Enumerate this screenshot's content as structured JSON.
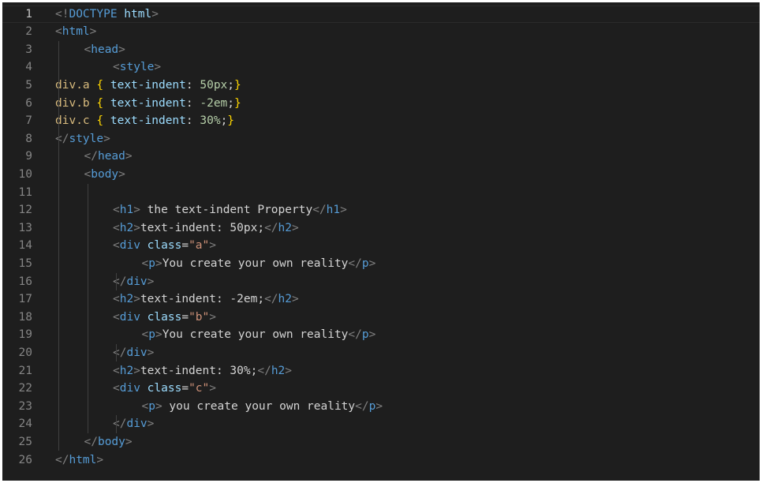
{
  "editor": {
    "current_line": 1,
    "lines": [
      {
        "n": "1",
        "indent": 0,
        "tokens": [
          {
            "c": "p",
            "t": "<!"
          },
          {
            "c": "t",
            "t": "DOCTYPE"
          },
          {
            "c": "a",
            "t": " html"
          },
          {
            "c": "p",
            "t": ">"
          }
        ]
      },
      {
        "n": "2",
        "indent": 0,
        "tokens": [
          {
            "c": "p",
            "t": "<"
          },
          {
            "c": "t",
            "t": "html"
          },
          {
            "c": "p",
            "t": ">"
          }
        ]
      },
      {
        "n": "3",
        "indent": 1,
        "tokens": [
          {
            "c": "p",
            "t": "<"
          },
          {
            "c": "t",
            "t": "head"
          },
          {
            "c": "p",
            "t": ">"
          }
        ]
      },
      {
        "n": "4",
        "indent": 2,
        "tokens": [
          {
            "c": "p",
            "t": "<"
          },
          {
            "c": "t",
            "t": "style"
          },
          {
            "c": "p",
            "t": ">"
          }
        ]
      },
      {
        "n": "5",
        "indent": 0,
        "tokens": [
          {
            "c": "sel",
            "t": "div.a"
          },
          {
            "c": "txt",
            "t": " "
          },
          {
            "c": "br",
            "t": "{"
          },
          {
            "c": "txt",
            "t": " "
          },
          {
            "c": "prop",
            "t": "text-indent"
          },
          {
            "c": "txt",
            "t": ": "
          },
          {
            "c": "num",
            "t": "50px"
          },
          {
            "c": "txt",
            "t": ";"
          },
          {
            "c": "br",
            "t": "}"
          }
        ]
      },
      {
        "n": "6",
        "indent": 0,
        "tokens": [
          {
            "c": "sel",
            "t": "div.b"
          },
          {
            "c": "txt",
            "t": " "
          },
          {
            "c": "br",
            "t": "{"
          },
          {
            "c": "txt",
            "t": " "
          },
          {
            "c": "prop",
            "t": "text-indent"
          },
          {
            "c": "txt",
            "t": ": "
          },
          {
            "c": "num",
            "t": "-2em"
          },
          {
            "c": "txt",
            "t": ";"
          },
          {
            "c": "br",
            "t": "}"
          }
        ]
      },
      {
        "n": "7",
        "indent": 0,
        "tokens": [
          {
            "c": "sel",
            "t": "div.c"
          },
          {
            "c": "txt",
            "t": " "
          },
          {
            "c": "br",
            "t": "{"
          },
          {
            "c": "txt",
            "t": " "
          },
          {
            "c": "prop",
            "t": "text-indent"
          },
          {
            "c": "txt",
            "t": ": "
          },
          {
            "c": "num",
            "t": "30%"
          },
          {
            "c": "txt",
            "t": ";"
          },
          {
            "c": "br",
            "t": "}"
          }
        ]
      },
      {
        "n": "8",
        "indent": 0,
        "tokens": [
          {
            "c": "p",
            "t": "</"
          },
          {
            "c": "t",
            "t": "style"
          },
          {
            "c": "p",
            "t": ">"
          }
        ]
      },
      {
        "n": "9",
        "indent": 1,
        "tokens": [
          {
            "c": "p",
            "t": "</"
          },
          {
            "c": "t",
            "t": "head"
          },
          {
            "c": "p",
            "t": ">"
          }
        ]
      },
      {
        "n": "10",
        "indent": 1,
        "tokens": [
          {
            "c": "p",
            "t": "<"
          },
          {
            "c": "t",
            "t": "body"
          },
          {
            "c": "p",
            "t": ">"
          }
        ]
      },
      {
        "n": "11",
        "indent": 0,
        "tokens": []
      },
      {
        "n": "12",
        "indent": 2,
        "tokens": [
          {
            "c": "p",
            "t": "<"
          },
          {
            "c": "t",
            "t": "h1"
          },
          {
            "c": "p",
            "t": ">"
          },
          {
            "c": "txt",
            "t": " the text-indent Property"
          },
          {
            "c": "p",
            "t": "</"
          },
          {
            "c": "t",
            "t": "h1"
          },
          {
            "c": "p",
            "t": ">"
          }
        ]
      },
      {
        "n": "13",
        "indent": 2,
        "tokens": [
          {
            "c": "p",
            "t": "<"
          },
          {
            "c": "t",
            "t": "h2"
          },
          {
            "c": "p",
            "t": ">"
          },
          {
            "c": "txt",
            "t": "text-indent: 50px;"
          },
          {
            "c": "p",
            "t": "</"
          },
          {
            "c": "t",
            "t": "h2"
          },
          {
            "c": "p",
            "t": ">"
          }
        ]
      },
      {
        "n": "14",
        "indent": 2,
        "tokens": [
          {
            "c": "p",
            "t": "<"
          },
          {
            "c": "t",
            "t": "div"
          },
          {
            "c": "a",
            "t": " class"
          },
          {
            "c": "txt",
            "t": "="
          },
          {
            "c": "s",
            "t": "\"a\""
          },
          {
            "c": "p",
            "t": ">"
          }
        ]
      },
      {
        "n": "15",
        "indent": 3,
        "tokens": [
          {
            "c": "p",
            "t": "<"
          },
          {
            "c": "t",
            "t": "p"
          },
          {
            "c": "p",
            "t": ">"
          },
          {
            "c": "txt",
            "t": "You create your own reality"
          },
          {
            "c": "p",
            "t": "</"
          },
          {
            "c": "t",
            "t": "p"
          },
          {
            "c": "p",
            "t": ">"
          }
        ]
      },
      {
        "n": "16",
        "indent": 2,
        "tokens": [
          {
            "c": "p",
            "t": "</"
          },
          {
            "c": "t",
            "t": "div"
          },
          {
            "c": "p",
            "t": ">"
          }
        ]
      },
      {
        "n": "17",
        "indent": 2,
        "tokens": [
          {
            "c": "p",
            "t": "<"
          },
          {
            "c": "t",
            "t": "h2"
          },
          {
            "c": "p",
            "t": ">"
          },
          {
            "c": "txt",
            "t": "text-indent: -2em;"
          },
          {
            "c": "p",
            "t": "</"
          },
          {
            "c": "t",
            "t": "h2"
          },
          {
            "c": "p",
            "t": ">"
          }
        ]
      },
      {
        "n": "18",
        "indent": 2,
        "tokens": [
          {
            "c": "p",
            "t": "<"
          },
          {
            "c": "t",
            "t": "div"
          },
          {
            "c": "a",
            "t": " class"
          },
          {
            "c": "txt",
            "t": "="
          },
          {
            "c": "s",
            "t": "\"b\""
          },
          {
            "c": "p",
            "t": ">"
          }
        ]
      },
      {
        "n": "19",
        "indent": 3,
        "tokens": [
          {
            "c": "p",
            "t": "<"
          },
          {
            "c": "t",
            "t": "p"
          },
          {
            "c": "p",
            "t": ">"
          },
          {
            "c": "txt",
            "t": "You create your own reality"
          },
          {
            "c": "p",
            "t": "</"
          },
          {
            "c": "t",
            "t": "p"
          },
          {
            "c": "p",
            "t": ">"
          }
        ]
      },
      {
        "n": "20",
        "indent": 2,
        "tokens": [
          {
            "c": "p",
            "t": "</"
          },
          {
            "c": "t",
            "t": "div"
          },
          {
            "c": "p",
            "t": ">"
          }
        ]
      },
      {
        "n": "21",
        "indent": 2,
        "tokens": [
          {
            "c": "p",
            "t": "<"
          },
          {
            "c": "t",
            "t": "h2"
          },
          {
            "c": "p",
            "t": ">"
          },
          {
            "c": "txt",
            "t": "text-indent: 30%;"
          },
          {
            "c": "p",
            "t": "</"
          },
          {
            "c": "t",
            "t": "h2"
          },
          {
            "c": "p",
            "t": ">"
          }
        ]
      },
      {
        "n": "22",
        "indent": 2,
        "tokens": [
          {
            "c": "p",
            "t": "<"
          },
          {
            "c": "t",
            "t": "div"
          },
          {
            "c": "a",
            "t": " class"
          },
          {
            "c": "txt",
            "t": "="
          },
          {
            "c": "s",
            "t": "\"c\""
          },
          {
            "c": "p",
            "t": ">"
          }
        ]
      },
      {
        "n": "23",
        "indent": 3,
        "tokens": [
          {
            "c": "p",
            "t": "<"
          },
          {
            "c": "t",
            "t": "p"
          },
          {
            "c": "p",
            "t": ">"
          },
          {
            "c": "txt",
            "t": " you create your own reality"
          },
          {
            "c": "p",
            "t": "</"
          },
          {
            "c": "t",
            "t": "p"
          },
          {
            "c": "p",
            "t": ">"
          }
        ]
      },
      {
        "n": "24",
        "indent": 2,
        "tokens": [
          {
            "c": "p",
            "t": "</"
          },
          {
            "c": "t",
            "t": "div"
          },
          {
            "c": "p",
            "t": ">"
          }
        ]
      },
      {
        "n": "25",
        "indent": 1,
        "tokens": [
          {
            "c": "p",
            "t": "</"
          },
          {
            "c": "t",
            "t": "body"
          },
          {
            "c": "p",
            "t": ">"
          }
        ]
      },
      {
        "n": "26",
        "indent": 0,
        "tokens": [
          {
            "c": "p",
            "t": "</"
          },
          {
            "c": "t",
            "t": "html"
          },
          {
            "c": "p",
            "t": ">"
          }
        ]
      }
    ],
    "guides": [
      {
        "level": 1,
        "from": 3,
        "to": 25
      },
      {
        "level": 2,
        "from": 11,
        "to": 24
      },
      {
        "level": 3,
        "from": 16,
        "to": 16
      },
      {
        "level": 3,
        "from": 20,
        "to": 20
      },
      {
        "level": 3,
        "from": 24,
        "to": 24
      }
    ],
    "colors": {
      "background": "#1e1e1e",
      "punctuation": "#808080",
      "tag": "#569cd6",
      "attribute": "#9cdcfe",
      "string": "#ce9178",
      "selector": "#d7ba7d",
      "number": "#b5cea8",
      "bracket": "#ffd700",
      "text": "#d4d4d4"
    }
  }
}
